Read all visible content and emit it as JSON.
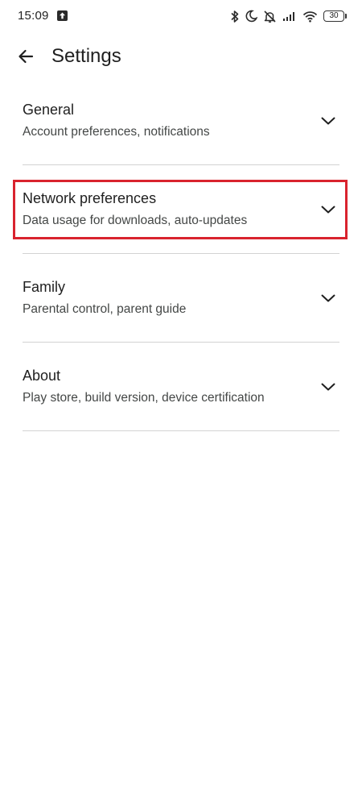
{
  "status_bar": {
    "time": "15:09",
    "battery": "30",
    "icons": [
      "upload-icon",
      "bluetooth-icon",
      "moon-icon",
      "mute-icon",
      "signal-icon",
      "wifi-icon",
      "battery-icon"
    ]
  },
  "app_bar": {
    "back_icon": "arrow-left-icon",
    "title": "Settings"
  },
  "settings": {
    "items": [
      {
        "title": "General",
        "subtitle": "Account preferences, notifications",
        "icon": "chevron-down-icon"
      },
      {
        "title": "Network preferences",
        "subtitle": "Data usage for downloads, auto-updates",
        "icon": "chevron-down-icon"
      },
      {
        "title": "Family",
        "subtitle": "Parental control, parent guide",
        "icon": "chevron-down-icon"
      },
      {
        "title": "About",
        "subtitle": "Play store, build version, device certification",
        "icon": "chevron-down-icon"
      }
    ]
  },
  "highlight": {
    "color": "#d9232e"
  }
}
